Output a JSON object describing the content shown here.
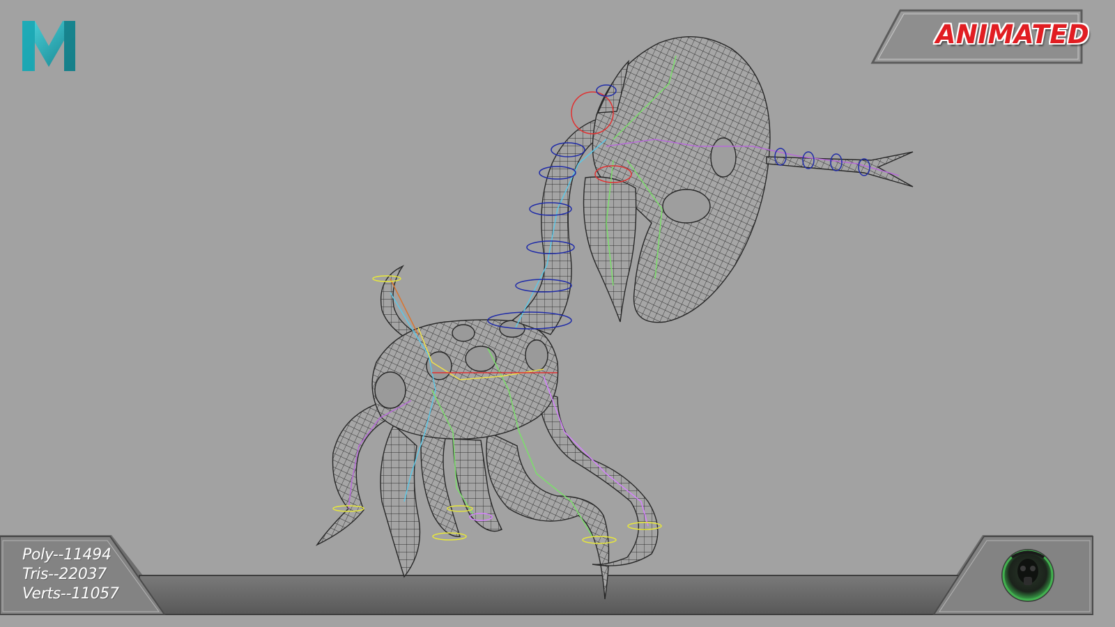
{
  "badge": {
    "label": "ANIMATED"
  },
  "app_logo": {
    "letter": "M",
    "icon": "maya-logo-icon"
  },
  "stats": {
    "poly": "Poly--11494",
    "tris": "Tris--22037",
    "verts": "Verts--11057"
  },
  "studio_logo": {
    "icon": "gasmask-logo-icon"
  },
  "colors": {
    "background": "#a2a2a2",
    "badge_text": "#e11d22",
    "logo_teal": "#1fb3c0",
    "mesh_wire": "#2a2a2a"
  }
}
